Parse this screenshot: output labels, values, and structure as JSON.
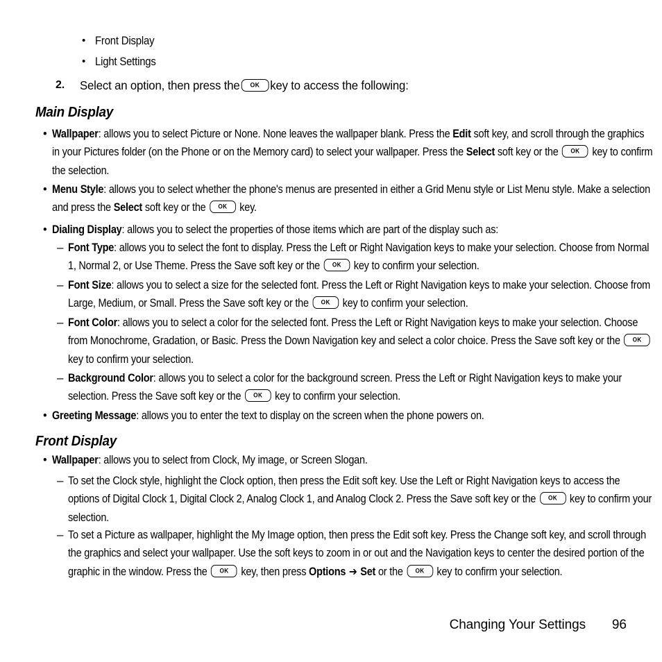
{
  "document": {
    "type": "phone-user-manual-page",
    "page_number": "96",
    "footer_section_title": "Changing Your Settings"
  },
  "intro_list": {
    "bullets": [
      {
        "label": "Front Display"
      },
      {
        "label": "Light Settings"
      }
    ],
    "step": {
      "number": "2.",
      "text_before_key": "Select an option, then press the",
      "key_label": "OK",
      "text_after_key": "key to access the following:"
    }
  },
  "sections": [
    {
      "heading": "Main Display",
      "items": [
        {
          "level": 1,
          "term": "Wallpaper",
          "segments": [
            {
              "type": "text",
              "value": ": allows you to select Picture or None. None leaves the wallpaper blank. Press the "
            },
            {
              "type": "bold",
              "value": "Edit"
            },
            {
              "type": "text",
              "value": " soft key, and scroll through the graphics in your Pictures folder (on the Phone or on the Memory card) to select your wallpaper. Press the "
            },
            {
              "type": "bold",
              "value": "Select"
            },
            {
              "type": "text",
              "value": " soft key or the "
            },
            {
              "type": "key",
              "value": "OK"
            },
            {
              "type": "text",
              "value": " key to confirm the selection."
            }
          ]
        },
        {
          "level": 1,
          "term": "Menu Style",
          "segments": [
            {
              "type": "text",
              "value": ": allows you to select whether the phone's menus are presented in either a Grid Menu style or List Menu style. Make a selection and press the "
            },
            {
              "type": "bold",
              "value": "Select"
            },
            {
              "type": "text",
              "value": " soft key or the "
            },
            {
              "type": "key",
              "value": "OK"
            },
            {
              "type": "text",
              "value": " key."
            }
          ]
        },
        {
          "level": 1,
          "term": "Dialing Display",
          "segments": [
            {
              "type": "text",
              "value": ": allows you to select the properties of those items which are part of the display such as:"
            }
          ]
        },
        {
          "level": 2,
          "term": "Font Type",
          "segments": [
            {
              "type": "text",
              "value": ": allows you to select the font to display. Press the Left or Right Navigation keys to make your selection. Choose from Normal 1, Normal 2, or Use Theme. Press the Save soft key or the "
            },
            {
              "type": "key",
              "value": "OK"
            },
            {
              "type": "text",
              "value": " key to confirm your selection."
            }
          ]
        },
        {
          "level": 2,
          "term": "Font Size",
          "segments": [
            {
              "type": "text",
              "value": ": allows you to select a size for the selected font. Press the Left or Right Navigation keys to make your selection. Choose from Large, Medium, or Small. Press the Save soft key or the "
            },
            {
              "type": "key",
              "value": "OK"
            },
            {
              "type": "text",
              "value": " key to confirm your selection."
            }
          ]
        },
        {
          "level": 2,
          "term": "Font Color",
          "segments": [
            {
              "type": "text",
              "value": ": allows you to select a color for the selected font. Press the Left or Right Navigation keys to make your selection. Choose from Monochrome, Gradation, or Basic. Press the Down Navigation key and select a color choice. Press the Save soft key or the "
            },
            {
              "type": "key",
              "value": "OK"
            },
            {
              "type": "text",
              "value": " key to confirm your selection."
            }
          ]
        },
        {
          "level": 2,
          "term": "Background Color",
          "segments": [
            {
              "type": "text",
              "value": ": allows you to select a color for the background screen. Press the Left or Right Navigation keys to make your selection. Press the Save soft key or the "
            },
            {
              "type": "key",
              "value": "OK"
            },
            {
              "type": "text",
              "value": " key to confirm your selection."
            }
          ]
        },
        {
          "level": 1,
          "term": "Greeting Message",
          "segments": [
            {
              "type": "text",
              "value": ": allows you to enter the text to display on the screen when the phone powers on."
            }
          ]
        }
      ]
    },
    {
      "heading": "Front Display",
      "items": [
        {
          "level": 1,
          "term": "Wallpaper",
          "segments": [
            {
              "type": "text",
              "value": ": allows you to select from Clock, My image, or Screen Slogan."
            }
          ]
        },
        {
          "level": 2,
          "term": "",
          "segments": [
            {
              "type": "text",
              "value": "To set the Clock style, highlight the Clock option, then press the Edit soft key. Use the Left or Right Navigation keys to access the options of Digital Clock 1, Digital Clock 2, Analog Clock 1, and Analog Clock 2. Press the Save soft key or the "
            },
            {
              "type": "key",
              "value": "OK"
            },
            {
              "type": "text",
              "value": " key to confirm your selection."
            }
          ]
        },
        {
          "level": 2,
          "term": "",
          "segments": [
            {
              "type": "text",
              "value": "To set a Picture as wallpaper, highlight the My Image option, then press the Edit soft key. Press the Change soft key, and scroll through the graphics and select your wallpaper. Use the soft keys to zoom in or out and the Navigation keys to center the desired portion of the graphic in the window. Press the "
            },
            {
              "type": "key",
              "value": "OK"
            },
            {
              "type": "text",
              "value": " key, then press "
            },
            {
              "type": "bold",
              "value": "Options"
            },
            {
              "type": "arrow",
              "value": "➔"
            },
            {
              "type": "bold",
              "value": "Set"
            },
            {
              "type": "text",
              "value": " or the "
            },
            {
              "type": "key",
              "value": "OK"
            },
            {
              "type": "text",
              "value": " key to confirm your selection."
            }
          ]
        }
      ]
    }
  ],
  "markers": {
    "bullet_dot": "•",
    "dash": "–"
  },
  "colors": {
    "page_background": "#ffffff",
    "text": "#000000",
    "key_border": "#000000"
  }
}
